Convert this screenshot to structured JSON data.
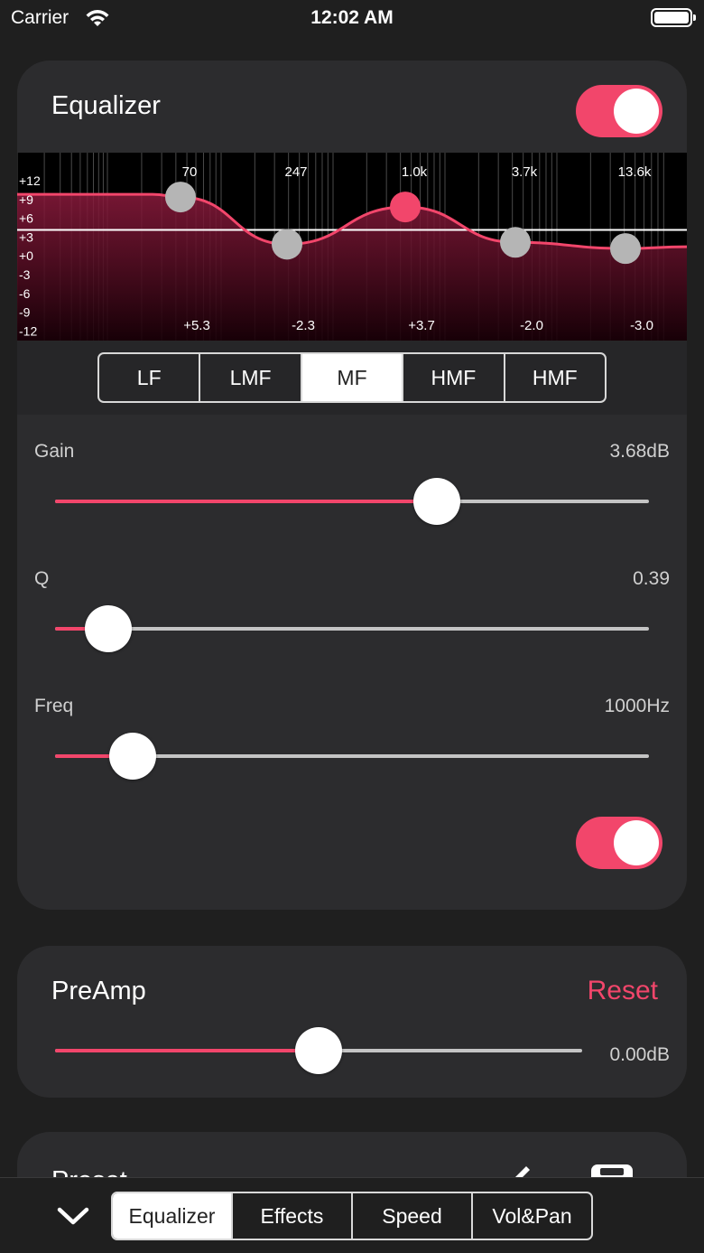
{
  "status_bar": {
    "carrier": "Carrier",
    "time": "12:02 AM"
  },
  "equalizer": {
    "title": "Equalizer",
    "enabled": true,
    "graph": {
      "db_labels": [
        "+12",
        "+9",
        "+6",
        "+3",
        "+0",
        "-3",
        "-6",
        "-9",
        "-12"
      ],
      "freq_labels": [
        "70",
        "247",
        "1.0k",
        "3.7k",
        "13.6k"
      ],
      "gain_labels": [
        "+5.3",
        "-2.3",
        "+3.7",
        "-2.0",
        "-3.0"
      ],
      "db_range": [
        -12,
        12
      ],
      "points_db": [
        5.3,
        -2.3,
        3.7,
        -2.0,
        -3.0
      ],
      "active_point_index": 2,
      "curve_color": "#f2466b"
    },
    "bands": [
      {
        "label": "LF",
        "active": false
      },
      {
        "label": "LMF",
        "active": false
      },
      {
        "label": "MF",
        "active": true
      },
      {
        "label": "HMF",
        "active": false
      },
      {
        "label": "HMF",
        "active": false
      }
    ],
    "gain": {
      "label": "Gain",
      "value": "3.68dB",
      "fraction": 0.643
    },
    "q": {
      "label": "Q",
      "value": "0.39",
      "fraction": 0.09
    },
    "freq": {
      "label": "Freq",
      "value": "1000Hz",
      "fraction": 0.13
    },
    "band_enabled": true
  },
  "preamp": {
    "title": "PreAmp",
    "reset_label": "Reset",
    "value": "0.00dB",
    "fraction": 0.5
  },
  "preset": {
    "title": "Preset"
  },
  "bottom_tabs": [
    {
      "label": "Equalizer",
      "active": true
    },
    {
      "label": "Effects",
      "active": false
    },
    {
      "label": "Speed",
      "active": false
    },
    {
      "label": "Vol&Pan",
      "active": false
    }
  ],
  "colors": {
    "accent": "#f2466b",
    "card": "#2c2c2e",
    "background": "#1f1f1f"
  }
}
